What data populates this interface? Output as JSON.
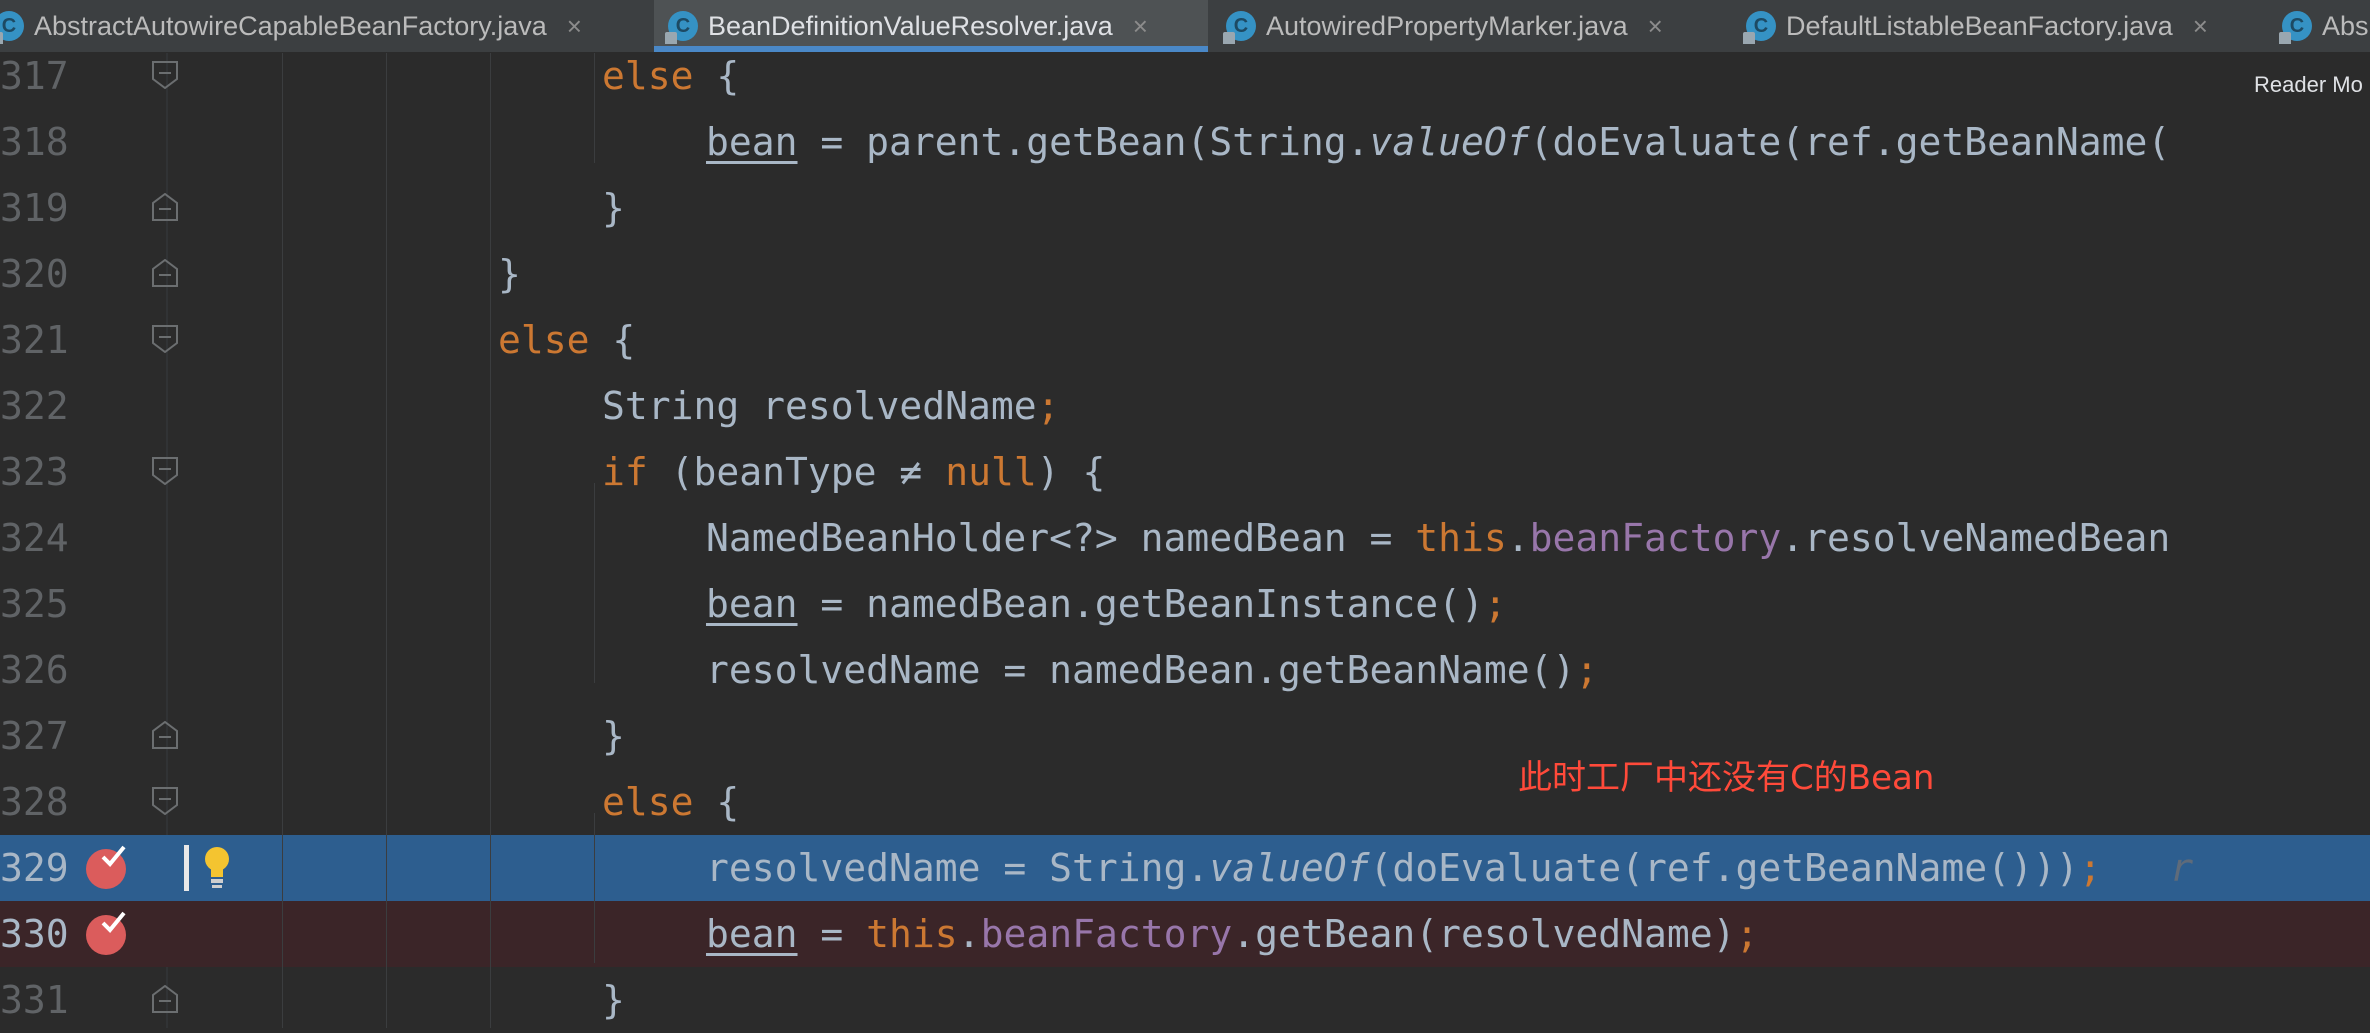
{
  "tabs": [
    {
      "label": "AbstractAutowireCapableBeanFactory.java",
      "icon": "class-icon",
      "active": false,
      "close": "×"
    },
    {
      "label": "BeanDefinitionValueResolver.java",
      "icon": "class-icon",
      "active": true,
      "close": "×"
    },
    {
      "label": "AutowiredPropertyMarker.java",
      "icon": "class-icon",
      "active": false,
      "close": "×"
    },
    {
      "label": "DefaultListableBeanFactory.java",
      "icon": "class-icon",
      "active": false,
      "close": "×"
    },
    {
      "label": "Abs",
      "icon": "class-icon",
      "active": false,
      "close": ""
    }
  ],
  "reader_mode": "Reader Mo",
  "annotation": "此时工厂中还没有C的Bean",
  "line_numbers": [
    "317",
    "318",
    "319",
    "320",
    "321",
    "322",
    "323",
    "324",
    "325",
    "326",
    "327",
    "328",
    "329",
    "330",
    "331"
  ],
  "code": {
    "l317": {
      "kw": "else",
      "rest": " {"
    },
    "l318": {
      "a": "bean",
      "b": " = parent.getBean(String.",
      "c": "valueOf",
      "d": "(doEvaluate(ref.getBeanName("
    },
    "l319": {
      "a": "}"
    },
    "l320": {
      "a": "}"
    },
    "l321": {
      "kw": "else",
      "rest": " {"
    },
    "l322": {
      "a": "String resolvedName",
      "semi": ";"
    },
    "l323": {
      "kw": "if",
      "a": " (beanType ≠ ",
      "kw2": "null",
      "b": ") {"
    },
    "l324": {
      "a": "NamedBeanHolder<?> namedBean = ",
      "kw": "this",
      "dot": ".",
      "field": "beanFactory",
      "b": ".resolveNamedBean"
    },
    "l325": {
      "a": "bean",
      "b": " = namedBean.getBeanInstance()",
      "semi": ";"
    },
    "l326": {
      "a": "resolvedName = namedBean.getBeanName()",
      "semi": ";"
    },
    "l327": {
      "a": "}"
    },
    "l328": {
      "kw": "else",
      "rest": " {"
    },
    "l329": {
      "a": "resolvedName = String.",
      "c": "valueOf",
      "d": "(doEvaluate(ref.getBeanName()))",
      "semi": ";",
      "note": "r"
    },
    "l330": {
      "a": "bean",
      "b": " = ",
      "kw": "this",
      "dot": ".",
      "field": "beanFactory",
      "c": ".getBean(resolvedName)",
      "semi": ";"
    },
    "l331": {
      "a": "}"
    }
  },
  "colors": {
    "keyword": "#cc7832",
    "field": "#9876aa",
    "text": "#a9b7c6",
    "execution_line": "#2d5e8f",
    "breakpoint_line": "#3b2528",
    "breakpoint": "#db5c5c",
    "annotation": "#ff4a3a"
  }
}
